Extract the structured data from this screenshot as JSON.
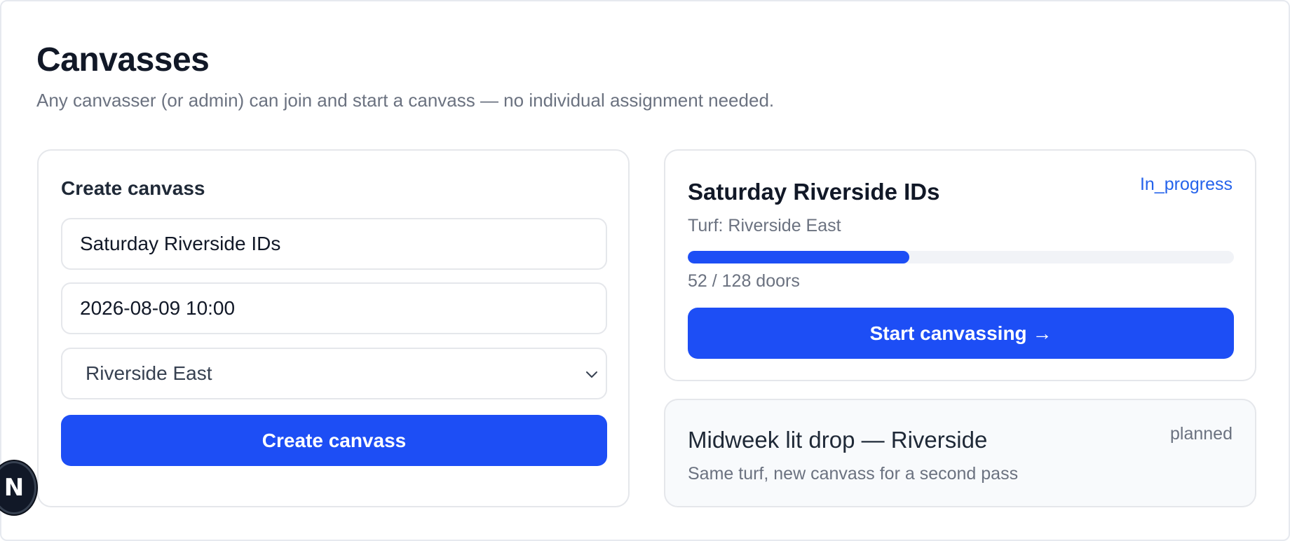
{
  "header": {
    "title": "Canvasses",
    "subtitle": "Any canvasser (or admin) can join and start a canvass — no individual assignment needed."
  },
  "create_form": {
    "title": "Create canvass",
    "name_value": "Saturday Riverside IDs",
    "datetime_value": "2026-08-09 10:00",
    "turf_selected": "Riverside East",
    "submit_label": "Create canvass",
    "chevron_icon": "chevron-down-icon"
  },
  "canvasses": [
    {
      "name": "Saturday Riverside IDs",
      "status": "In_progress",
      "turf_text": "Turf: Riverside East",
      "progress_fraction": 0.406,
      "progress_text": "52 / 128 doors",
      "action_label": "Start canvassing →"
    },
    {
      "name": "Midweek lit drop — Riverside",
      "status": "planned",
      "description": "Same turf, new canvass for a second pass"
    }
  ],
  "dev_indicator": {
    "letter": "N"
  },
  "colors": {
    "primary": "#1d4ef5",
    "status_link": "#2563eb",
    "muted_text": "#6b7280"
  }
}
